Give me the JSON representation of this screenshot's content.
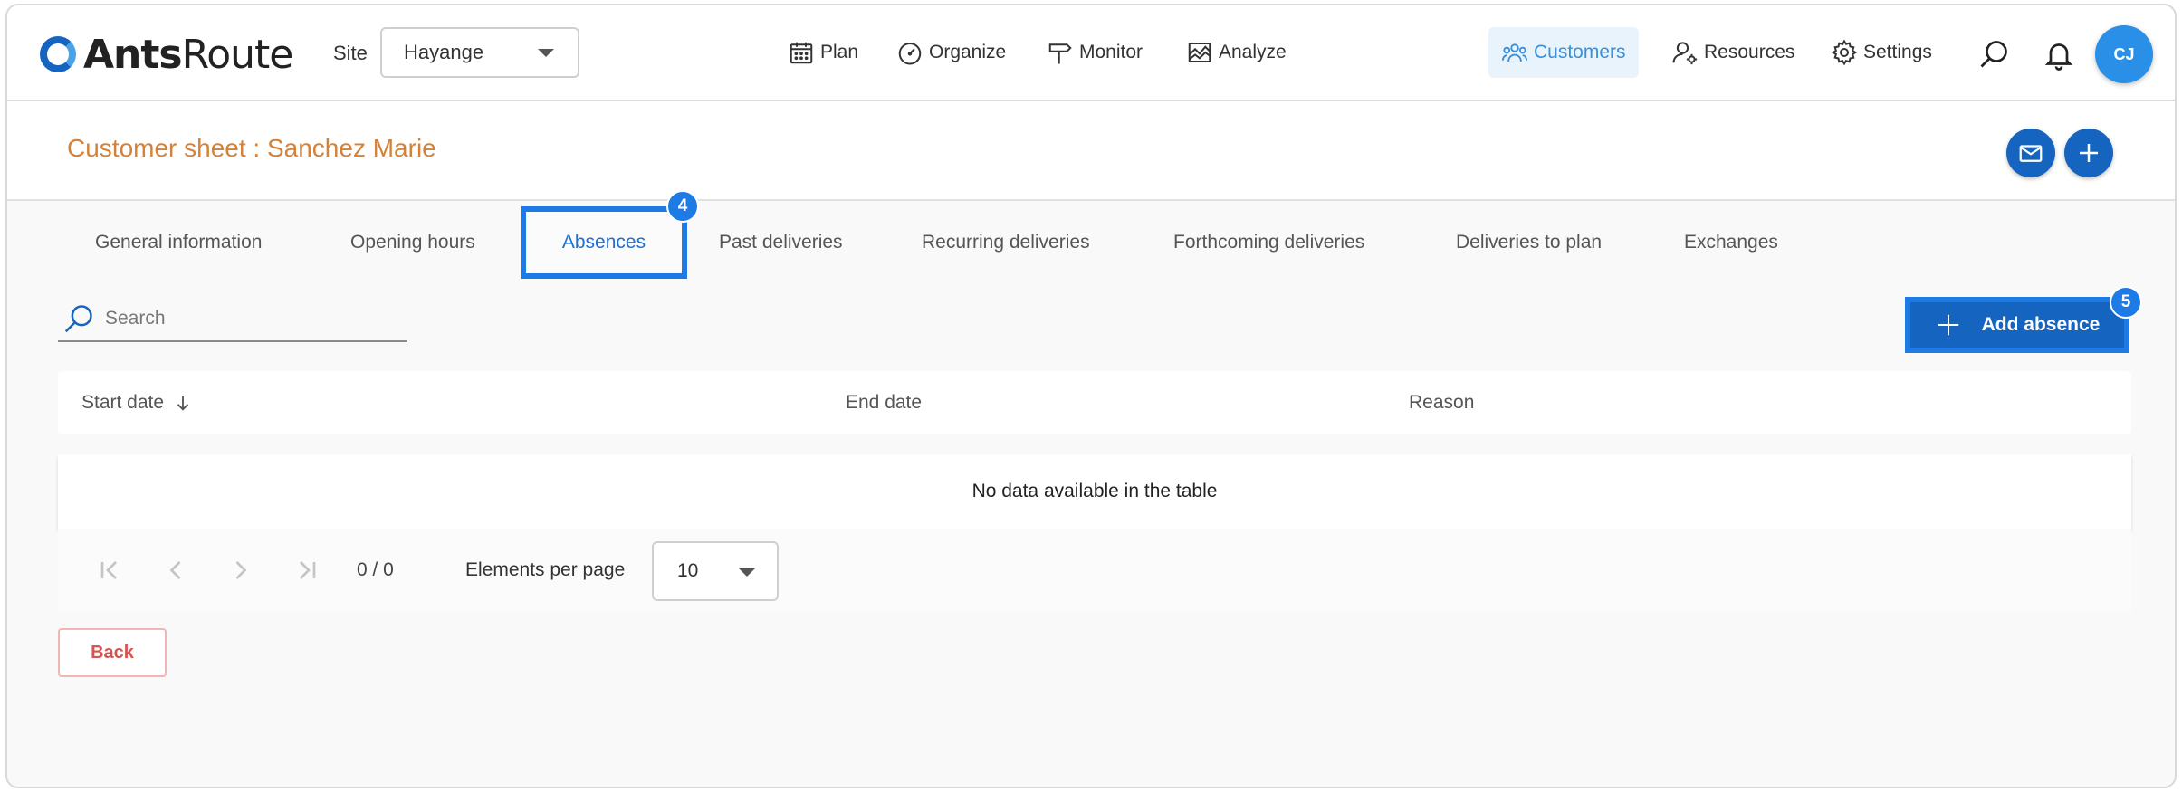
{
  "header": {
    "logo_bold": "Ants",
    "logo_light": "Route",
    "site_label": "Site",
    "site_value": "Hayange",
    "nav": {
      "plan": "Plan",
      "organize": "Organize",
      "monitor": "Monitor",
      "analyze": "Analyze",
      "customers": "Customers",
      "resources": "Resources",
      "settings": "Settings"
    },
    "avatar_initials": "CJ"
  },
  "page": {
    "title": "Customer sheet : Sanchez Marie"
  },
  "tabs": [
    {
      "label": "General information"
    },
    {
      "label": "Opening hours"
    },
    {
      "label": "Absences",
      "active": true
    },
    {
      "label": "Past deliveries"
    },
    {
      "label": "Recurring deliveries"
    },
    {
      "label": "Forthcoming deliveries"
    },
    {
      "label": "Deliveries to plan"
    },
    {
      "label": "Exchanges"
    }
  ],
  "badges": {
    "tab_badge": "4",
    "add_badge": "5"
  },
  "search": {
    "placeholder": "Search"
  },
  "actions": {
    "add_absence": "Add absence",
    "back": "Back"
  },
  "table": {
    "columns": [
      "Start date",
      "End date",
      "Reason"
    ],
    "sort_column": "Start date",
    "empty_text": "No data available in the table"
  },
  "pagination": {
    "count": "0 / 0",
    "per_page_label": "Elements per page",
    "per_page_value": "10"
  },
  "colors": {
    "primary": "#1565c0",
    "highlight": "#1e7be6",
    "title": "#d4823a",
    "back": "#d9534f"
  }
}
